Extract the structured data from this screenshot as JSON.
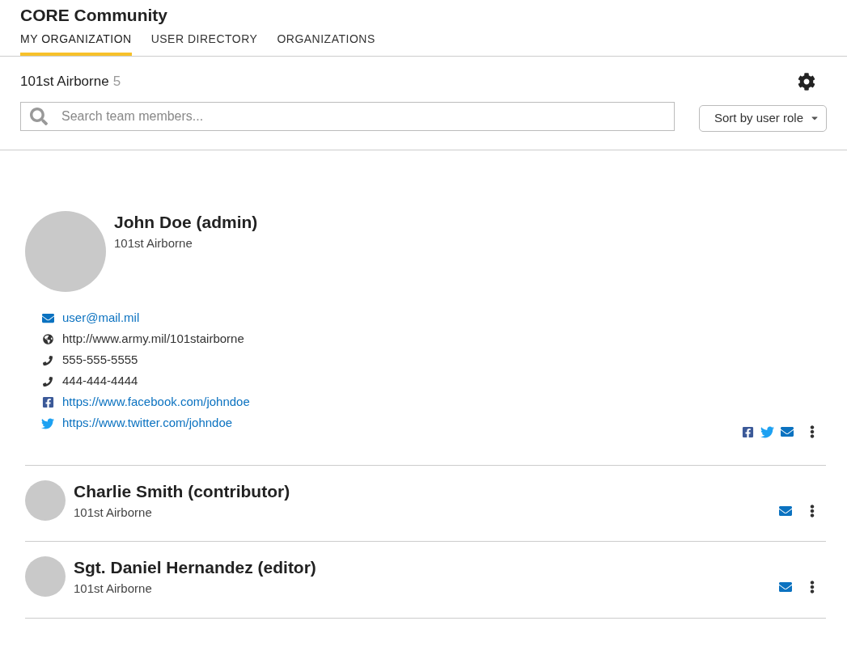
{
  "app_title": "CORE Community",
  "tabs": [
    {
      "label": "MY ORGANIZATION",
      "selected": true
    },
    {
      "label": "USER DIRECTORY",
      "selected": false
    },
    {
      "label": "ORGANIZATIONS",
      "selected": false
    }
  ],
  "organization": {
    "name": "101st Airborne",
    "count": "5"
  },
  "search": {
    "placeholder": "Search team members..."
  },
  "sort": {
    "label": "Sort by user role"
  },
  "members": [
    {
      "name": "John Doe (admin)",
      "organization": "101st Airborne",
      "expanded": true,
      "contacts": [
        {
          "kind": "email",
          "text": "user@mail.mil"
        },
        {
          "kind": "web",
          "text": "http://www.army.mil/101stairborne"
        },
        {
          "kind": "phone",
          "text": "555-555-5555"
        },
        {
          "kind": "phone",
          "text": "444-444-4444"
        },
        {
          "kind": "facebook",
          "text": "https://www.facebook.com/johndoe"
        },
        {
          "kind": "twitter",
          "text": "https://www.twitter.com/johndoe"
        }
      ],
      "actions": [
        {
          "kind": "facebook"
        },
        {
          "kind": "twitter"
        },
        {
          "kind": "email"
        }
      ]
    },
    {
      "name": "Charlie Smith (contributor)",
      "organization": "101st Airborne",
      "expanded": false,
      "actions": [
        {
          "kind": "email"
        }
      ]
    },
    {
      "name": "Sgt. Daniel Hernandez (editor)",
      "organization": "101st Airborne",
      "expanded": false,
      "actions": [
        {
          "kind": "email"
        }
      ]
    }
  ]
}
